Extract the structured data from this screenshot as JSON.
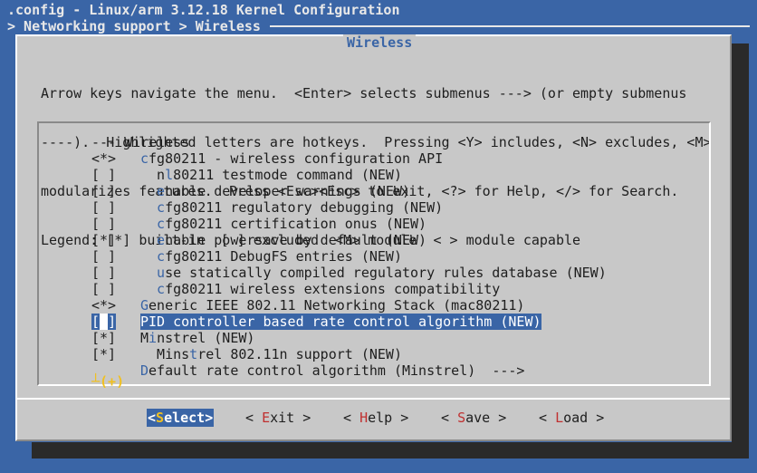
{
  "window": {
    "title": ".config - Linux/arm 3.12.18 Kernel Configuration",
    "breadcrumb": "> Networking support > Wireless"
  },
  "dialog": {
    "title": "Wireless",
    "help_lines": [
      "Arrow keys navigate the menu.  <Enter> selects submenus ---> (or empty submenus",
      "----).  Highlighted letters are hotkeys.  Pressing <Y> includes, <N> excludes, <M>",
      "modularizes features.  Press <Esc><Esc> to exit, <?> for Help, </> for Search.",
      "Legend: [*] built-in  [ ] excluded  <M> module  < > module capable"
    ]
  },
  "menu": {
    "items": [
      {
        "marker": "",
        "hot": "",
        "rest": "--- Wireless",
        "indent": 0
      },
      {
        "marker": "<*>",
        "hot": "c",
        "rest": "fg80211 - wireless configuration API",
        "indent": 0
      },
      {
        "marker": "[ ]",
        "hot": "n",
        "rest": "l80211 testmode command (NEW)",
        "indent": 1,
        "pre": "n",
        "hot2": "l"
      },
      {
        "marker": "[ ]",
        "hot": "e",
        "rest": "nable developer warnings (NEW)",
        "indent": 1
      },
      {
        "marker": "[ ]",
        "hot": "c",
        "rest": "fg80211 regulatory debugging (NEW)",
        "indent": 1
      },
      {
        "marker": "[ ]",
        "hot": "c",
        "rest": "fg80211 certification onus (NEW)",
        "indent": 1
      },
      {
        "marker": "[*]",
        "hot": "e",
        "rest": "nable powersave by default (NEW)",
        "indent": 1
      },
      {
        "marker": "[ ]",
        "hot": "c",
        "rest": "fg80211 DebugFS entries (NEW)",
        "indent": 1
      },
      {
        "marker": "[ ]",
        "hot": "u",
        "rest": "se statically compiled regulatory rules database (NEW)",
        "indent": 1
      },
      {
        "marker": "[ ]",
        "hot": "c",
        "rest": "fg80211 wireless extensions compatibility",
        "indent": 1
      },
      {
        "marker": "<*>",
        "hot": "G",
        "rest": "eneric IEEE 802.11 Networking Stack (mac80211)",
        "indent": 0
      },
      {
        "marker": "[ ]",
        "hot": "P",
        "rest": "ID controller based rate control algorithm (NEW)",
        "indent": 0,
        "selected": true
      },
      {
        "marker": "[*]",
        "hot": "",
        "rest": "Minstrel (NEW)",
        "indent": 0,
        "hotpos": 1
      },
      {
        "marker": "[*]",
        "hot": "",
        "rest": "Minstrel 802.11n support (NEW)",
        "indent": 1,
        "hotpos": 4
      },
      {
        "marker": "",
        "hot": "D",
        "rest": "efault rate control algorithm (Minstrel)  --->",
        "indent": 0
      }
    ],
    "more_indicator": "┴(+)"
  },
  "buttons": [
    {
      "pre": "<",
      "hot": "S",
      "post": "elect>",
      "active": true
    },
    {
      "pre": "< ",
      "hot": "E",
      "post": "xit >",
      "active": false
    },
    {
      "pre": "< ",
      "hot": "H",
      "post": "elp >",
      "active": false
    },
    {
      "pre": "< ",
      "hot": "S",
      "post": "ave >",
      "active": false
    },
    {
      "pre": "< ",
      "hot": "L",
      "post": "oad >",
      "active": false
    }
  ],
  "colors": {
    "background": "#3a65a6",
    "dialog": "#c8c8c8",
    "hotkey_menu": "#3a65a6",
    "hotkey_button": "#c03030",
    "more_indicator": "#f0c020"
  }
}
